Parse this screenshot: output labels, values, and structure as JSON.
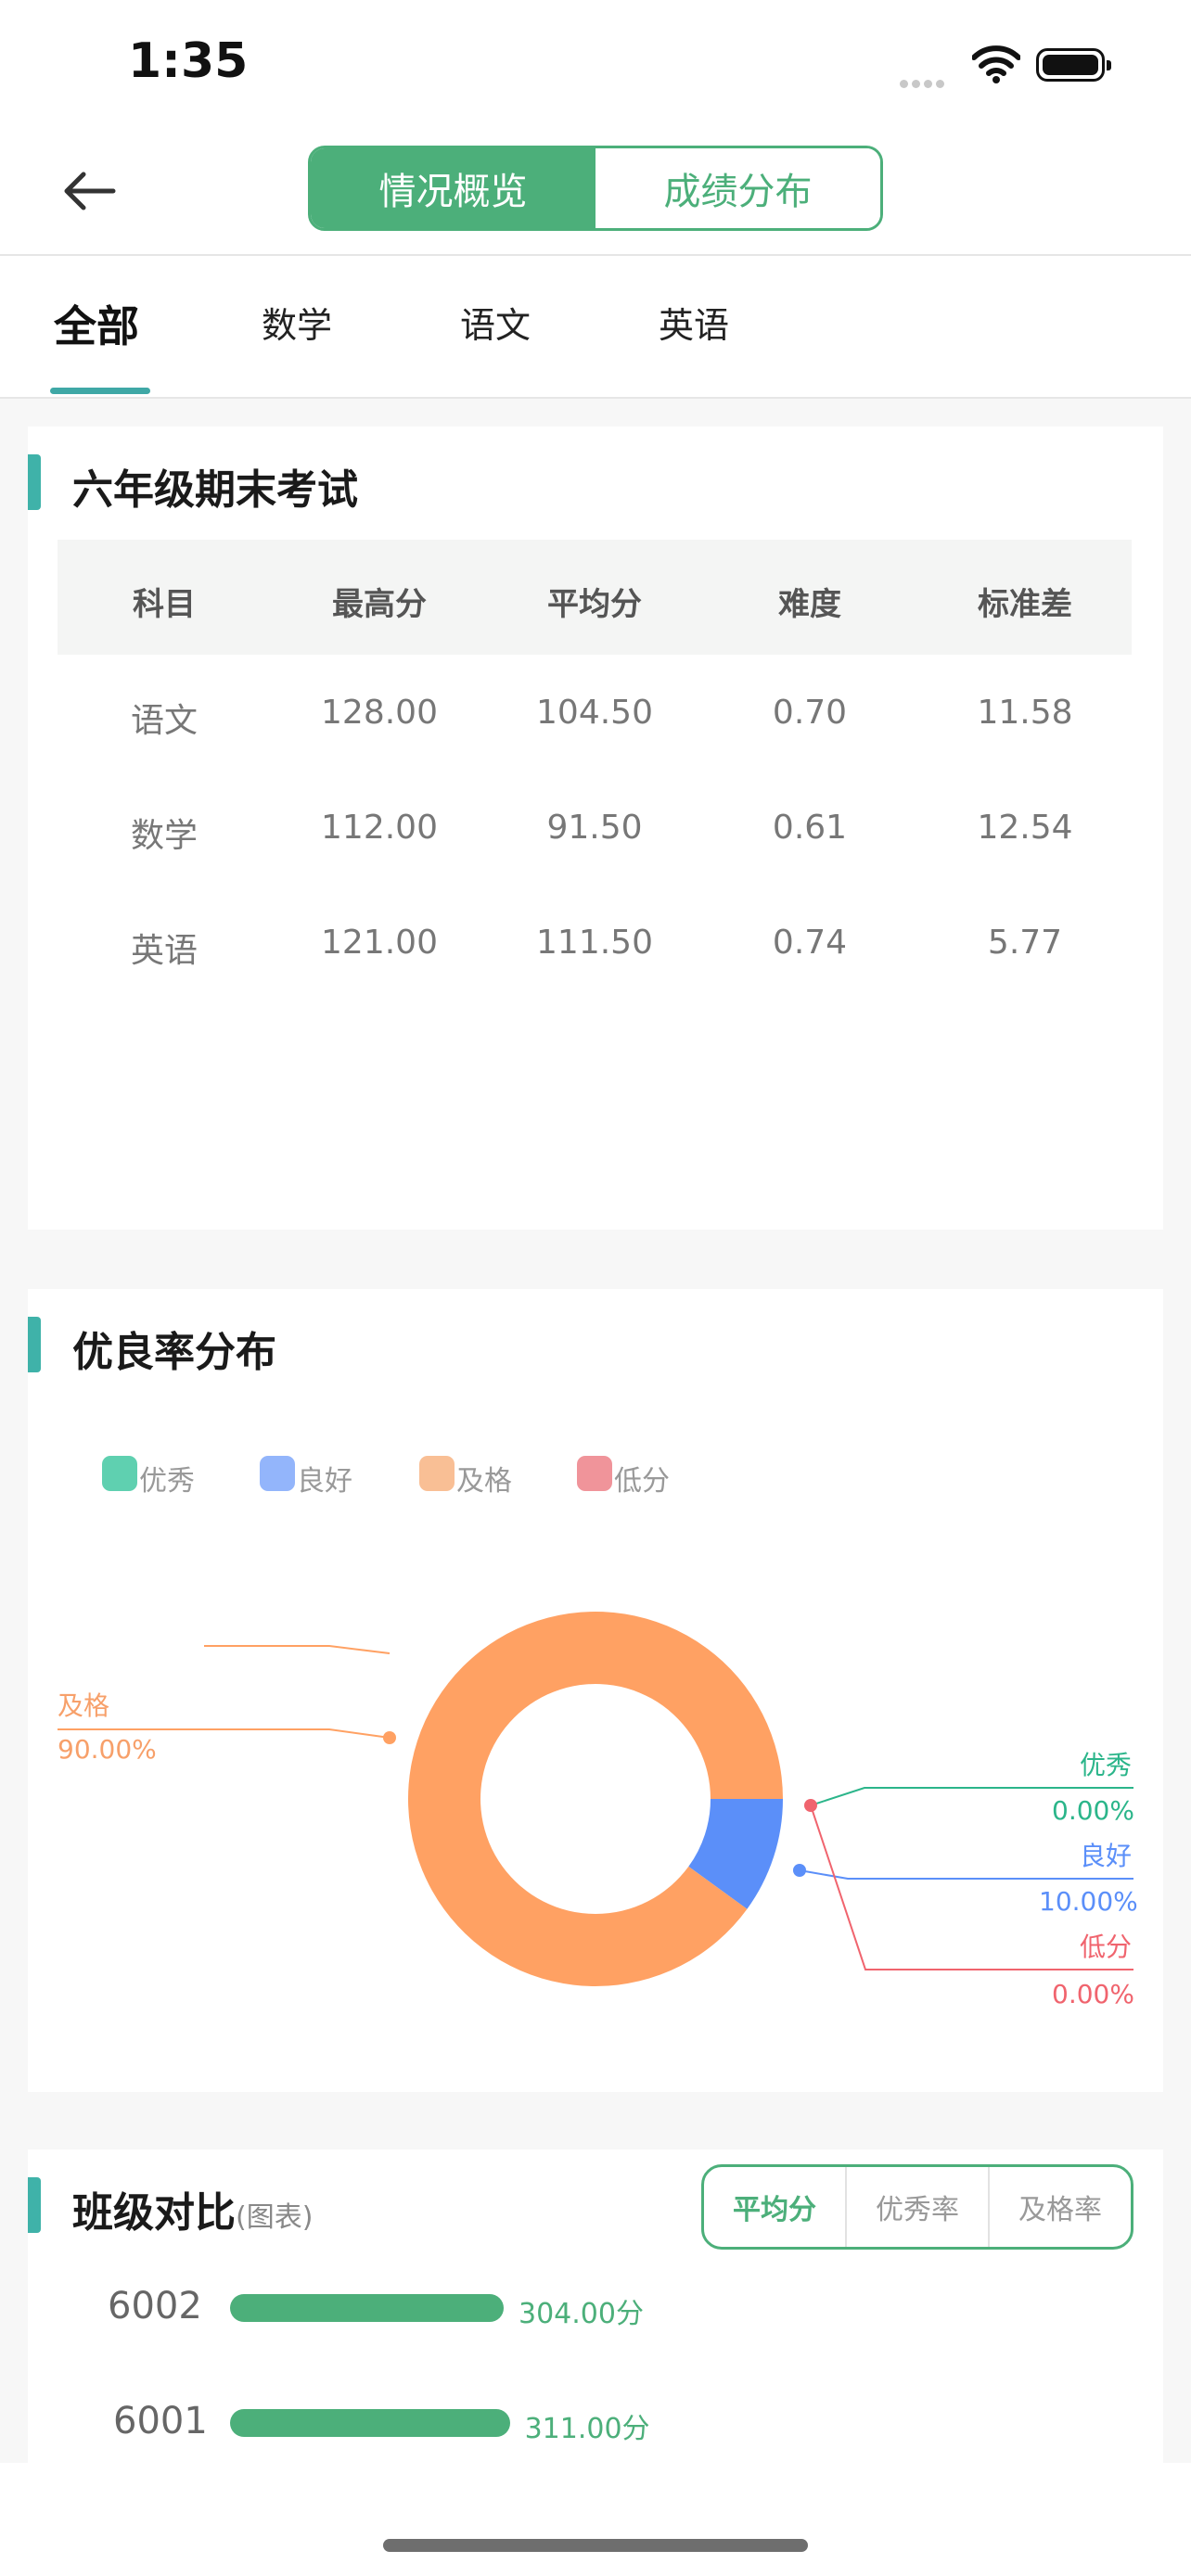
{
  "status_bar": {
    "time": "1:35"
  },
  "nav": {
    "segments": [
      "情况概览",
      "成绩分布"
    ],
    "active_segment": "情况概览"
  },
  "tabs": [
    "全部",
    "数学",
    "语文",
    "英语"
  ],
  "active_tab": "全部",
  "exam_card": {
    "title": "六年级期末考试",
    "headers": [
      "科目",
      "最高分",
      "平均分",
      "难度",
      "标准差"
    ],
    "rows": [
      [
        "语文",
        "128.00",
        "104.50",
        "0.70",
        "11.58"
      ],
      [
        "数学",
        "112.00",
        "91.50",
        "0.61",
        "12.54"
      ],
      [
        "英语",
        "121.00",
        "111.50",
        "0.74",
        "5.77"
      ]
    ]
  },
  "rate_card": {
    "title": "优良率分布",
    "legend": [
      "优秀",
      "良好",
      "及格",
      "低分"
    ],
    "labels": {
      "pass_name": "及格",
      "pass_value": "90.00%",
      "excellent_name": "优秀",
      "excellent_value": "0.00%",
      "good_name": "良好",
      "good_value": "10.00%",
      "low_name": "低分",
      "low_value": "0.00%"
    },
    "colors": {
      "excellent": "#5fd0b0",
      "good": "#5b8ff9",
      "pass": "#ffa163",
      "low": "#f0646e"
    }
  },
  "chart_data": {
    "type": "pie",
    "categories": [
      "优秀",
      "良好",
      "及格",
      "低分"
    ],
    "values": [
      0.0,
      10.0,
      90.0,
      0.0
    ]
  },
  "class_card": {
    "title": "班级对比",
    "title_suffix": "(图表)",
    "filters": [
      "平均分",
      "优秀率",
      "及格率"
    ],
    "active_filter": "平均分",
    "classes": [
      {
        "name": "6002",
        "value": 304.0,
        "label": "304.00分"
      },
      {
        "name": "6001",
        "value": 311.0,
        "label": "311.00分"
      }
    ]
  }
}
